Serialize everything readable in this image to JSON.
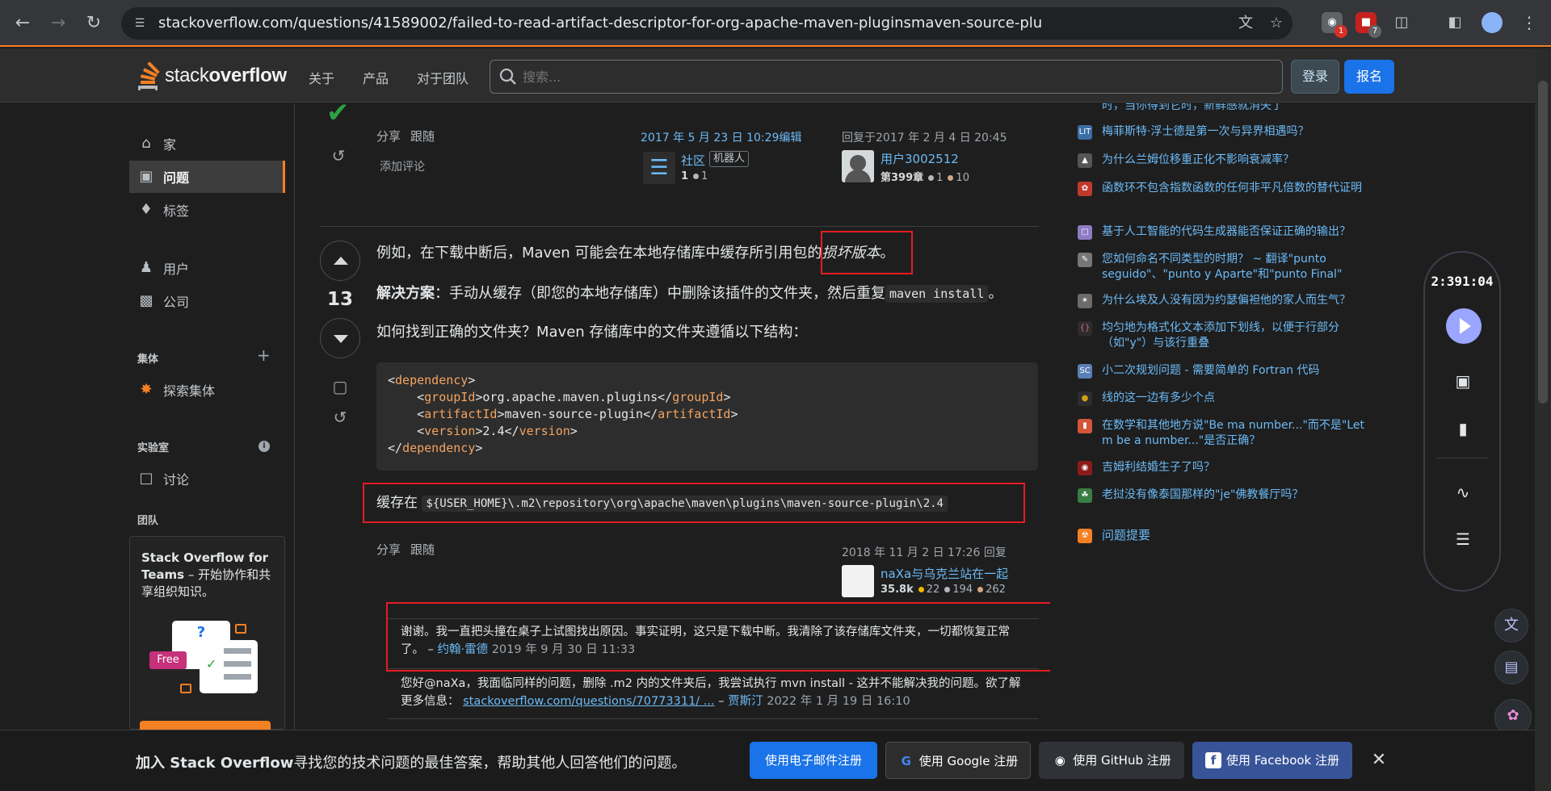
{
  "browser": {
    "url": "stackoverflow.com/questions/41589002/failed-to-read-artifact-descriptor-for-org-apache-maven-pluginsmaven-source-plu",
    "ext_badges": [
      "1",
      "7"
    ]
  },
  "topbar": {
    "logo_light": "stack",
    "logo_bold": "overflow",
    "nav": [
      "关于",
      "产品",
      "对于团队"
    ],
    "search_placeholder": "搜索...",
    "login": "登录",
    "signup": "报名"
  },
  "leftnav": {
    "items": [
      "家",
      "问题",
      "标签",
      "用户",
      "公司",
      "探索集体",
      "讨论"
    ],
    "heading_collectives": "集体",
    "heading_labs": "实验室",
    "heading_teams": "团队",
    "teams_title": "Stack Overflow for Teams",
    "teams_desc": " – 开始协作和共享组织知识。",
    "free_label": "Free"
  },
  "prev_post": {
    "share": "分享",
    "follow": "跟随",
    "edited": "2017 年 5 月 23 日 10:29编辑",
    "editor_name": "社区",
    "editor_tag": "机器人",
    "editor_rep": "1",
    "editor_silver": "1",
    "answered": "回复于2017 年 2 月 4 日 20:45",
    "author": "用户3002512",
    "author_rep": "第399章",
    "author_silver": "1",
    "author_bronze": "10",
    "add_comment": "添加评论"
  },
  "answer": {
    "votes": "13",
    "p1_prefix": "例如，在下载中断后，Maven 可能会在本地存储库中缓存所引用包的",
    "p1_em": "损坏版本",
    "p1_suffix": "。",
    "p2_bold": "解决方案",
    "p2_text": "：手动从缓存（即您的本地存储库）中删除该插件的文件夹，然后重复",
    "p2_code": "maven install",
    "p2_end": "。",
    "p3": "如何找到正确的文件夹？Maven 存储库中的文件夹遵循以下结构：",
    "code": {
      "dependency": "dependency",
      "groupId_tag": "groupId",
      "groupId_val": "org.apache.maven.plugins",
      "artifactId_tag": "artifactId",
      "artifactId_val": "maven-source-plugin",
      "version_tag": "version",
      "version_val": "2.4"
    },
    "cache_prefix": "缓存在",
    "cache_path": "${USER_HOME}\\.m2\\repository\\org\\apache\\maven\\plugins\\maven-source-plugin\\2.4",
    "share": "分享",
    "follow": "跟随",
    "answered": "2018 年 11 月 2 日 17:26 回复",
    "author": "naXa与乌克兰站在一起",
    "author_rep": "35.8k",
    "gold": "22",
    "silver": "194",
    "bronze": "262"
  },
  "comments": [
    {
      "text": "谢谢。我一直把头撞在桌子上试图找出原因。事实证明，这只是下载中断。我清除了该存储库文件夹，一切都恢复正常了。",
      "dash": " – ",
      "user": "约翰·雷德",
      "time": "2019 年 9 月 30 日 11:33"
    },
    {
      "text": "您好@naXa，我面临同样的问题，删除 .m2 内的文件夹后，我尝试执行 mvn install - 这并不能解决我的问题。欲了解更多信息：",
      "link": "stackoverflow.com/questions/70773311/ ...",
      "dash": " – ",
      "user": "贾斯汀",
      "time": "2022 年 1 月 19 日 16:10"
    }
  ],
  "hot_questions": [
    "时，当你得到它时，新鲜感就消失了",
    "梅菲斯特·浮士德是第一次与异界相遇吗？",
    "为什么兰姆位移重正化不影响衰减率？",
    "函数环不包含指数函数的任何非平凡倍数的替代证明",
    "基于人工智能的代码生成器能否保证正确的输出？",
    "您如何命名不同类型的时期？ ~ 翻译\"punto seguido\"、\"punto y Aparte\"和\"punto Final\"",
    "为什么埃及人没有因为约瑟偏袒他的家人而生气？",
    "均匀地为格式化文本添加下划线，以便于行部分（如\"y\"）与该行重叠",
    "小二次规划问题 - 需要简单的 Fortran 代码",
    "线的这一边有多少个点",
    "在数学和其他地方说\"Be ma number...\"而不是\"Let m be a number...\"是否正确？",
    "吉姆利结婚生子了吗？",
    "老挝没有像泰国那样的\"je\"佛教餐厅吗？"
  ],
  "feed_label": "问题提要",
  "widget": {
    "timer": "2:391:04"
  },
  "banner": {
    "bold": "加入 Stack Overflow",
    "text": "寻找您的技术问题的最佳答案，帮助其他人回答他们的问题。",
    "email": "使用电子邮件注册",
    "google": "使用 Google 注册",
    "github": "使用 GitHub 注册",
    "facebook": "使用 Facebook 注册"
  },
  "colors": {
    "accent": "#f48024",
    "link": "#6cbbf7",
    "primary_button": "#1a73e8",
    "highlight_box": "#e51c23"
  }
}
